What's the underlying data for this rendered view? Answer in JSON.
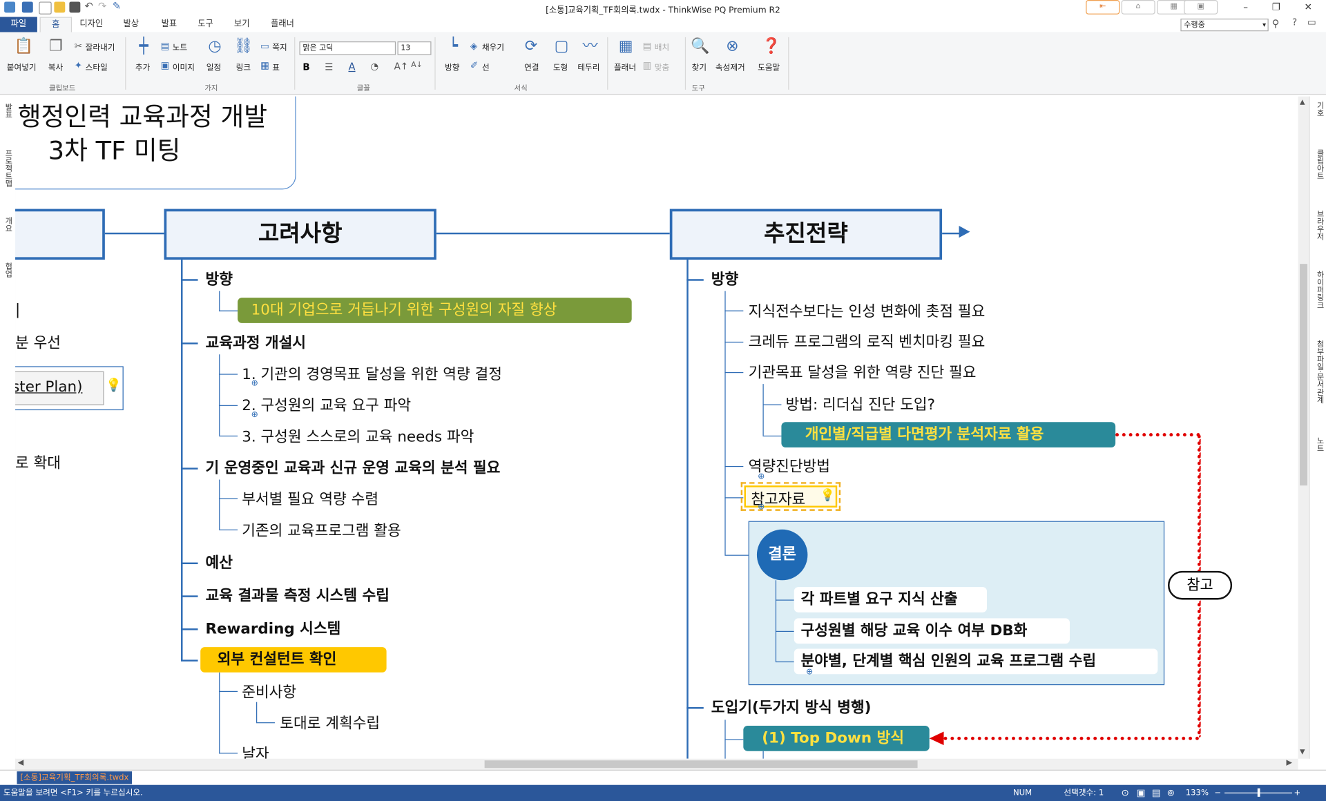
{
  "window": {
    "title": "[소통]교육기획_TF회의록.twdx - ThinkWise PQ Premium R2",
    "minimize": "–",
    "restore": "❐",
    "close": "✕"
  },
  "tabs": [
    "파일",
    "홈",
    "디자인",
    "발상",
    "발표",
    "도구",
    "보기",
    "플래너"
  ],
  "view_mode": "수행중",
  "ribbon": {
    "paste": "붙여넣기",
    "copy": "복사",
    "cut": "잘라내기",
    "style": "스타일",
    "group_clipboard": "클립보드",
    "add": "추가",
    "note": "노트",
    "image": "이미지",
    "schedule": "일정",
    "link": "링크",
    "memo": "쪽지",
    "table": "표",
    "group_branch": "가지",
    "font_name": "맑은 고딕",
    "font_size": "13",
    "group_font": "글꼴",
    "direction": "방향",
    "fill": "채우기",
    "line": "선",
    "connect": "연결",
    "shape": "도형",
    "border": "테두리",
    "group_format": "서식",
    "planner": "플래너",
    "arrange": "배치",
    "align": "맞춤",
    "find": "찾기",
    "remove_props": "속성제거",
    "group_tools": "도구",
    "help": "도움말"
  },
  "left_pane": [
    "발표",
    "프로젝트맵",
    "개요",
    "협업"
  ],
  "right_pane": [
    "기호",
    "클립아트",
    "브라우저",
    "하이퍼링크",
    "첨부파일·문서관계",
    "노트"
  ],
  "map": {
    "title_line1": "행정인력 교육과정 개발",
    "title_line2": "3차 TF 미팅",
    "left_partial": {
      "item1": "|",
      "item2": "분 우선",
      "item3": "ster Plan)",
      "item4": "로 확대"
    },
    "center": {
      "title": "고려사항",
      "h1": "방향",
      "h1_1": "10대 기업으로 거듭나기 위한 구성원의 자질 향상",
      "h2": "교육과정 개설시",
      "h2_1": "1. 기관의 경영목표 달성을 위한 역량 결정",
      "h2_2": "2. 구성원의 교육 요구 파악",
      "h2_3": "3. 구성원 스스로의 교육 needs 파악",
      "h3": "기 운영중인 교육과 신규 운영 교육의 분석 필요",
      "h3_1": "부서별 필요 역량 수렴",
      "h3_2": "기존의 교육프로그램 활용",
      "h4": "예산",
      "h5": "교육 결과물 측정 시스템 수립",
      "h6": "Rewarding 시스템",
      "h7": "외부 컨설턴트 확인",
      "h7_1": "준비사항",
      "h7_1_1": "토대로 계획수립",
      "h7_2": "날자"
    },
    "right": {
      "title": "추진전략",
      "h1": "방향",
      "h1_1": "지식전수보다는 인성 변화에 촛점 필요",
      "h1_2": "크레듀 프로그램의 로직 벤치마킹 필요",
      "h1_3": "기관목표 달성을 위한 역량 진단 필요",
      "h1_3_1": "방법: 리더십 진단 도입?",
      "h1_3_2": "개인별/직급별 다면평가 분석자료 활용",
      "h1_4": "역량진단방법",
      "h1_5": "참고자료",
      "conclusion": "결론",
      "c1": "각 파트별 요구 지식 산출",
      "c2": "구성원별 해당 교육 이수 여부 DB화",
      "c3": "분야별, 단계별 핵심 인원의 교육 프로그램 수립",
      "h2": "도입기(두가지 방식 병행)",
      "h2_1": "(1) Top Down 방식"
    },
    "relation_label": "참고"
  },
  "document_tab": "[소통]교육기획_TF회의록.twdx",
  "status": {
    "help": "도움말을 보려면 <F1> 키를 누르십시오.",
    "num": "NUM",
    "selection": "선택갯수: 1",
    "zoom": "133%"
  },
  "colors": {
    "accent": "#2b579a",
    "branch": "#2e6cb5",
    "olive": "#7a9a3a",
    "teal": "#2a8a9a",
    "yellow_fill": "#ffc800",
    "relation": "#e00000"
  }
}
